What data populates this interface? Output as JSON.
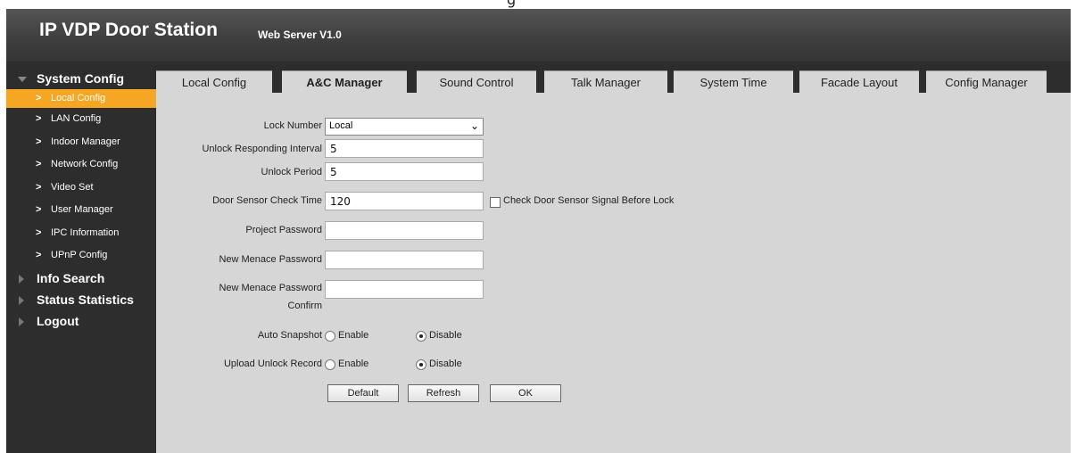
{
  "top_label": "g",
  "header": {
    "title": "IP VDP Door Station",
    "subtitle": "Web Server V1.0"
  },
  "sidebar": {
    "system_config": "System Config",
    "items": [
      "Local Config",
      "LAN Config",
      "Indoor Manager",
      "Network Config",
      "Video Set",
      "User Manager",
      "IPC Information",
      "UPnP Config"
    ],
    "info_search": "Info Search",
    "status_statistics": "Status Statistics",
    "logout": "Logout",
    "chevron": ">"
  },
  "tabs": [
    "Local Config",
    "A&C Manager",
    "Sound Control",
    "Talk Manager",
    "System Time",
    "Facade Layout",
    "Config Manager"
  ],
  "form": {
    "lock_number_label": "Lock Number",
    "lock_number_value": "Local",
    "unlock_interval_label": "Unlock Responding Interval",
    "unlock_interval_value": "5",
    "unlock_period_label": "Unlock Period",
    "unlock_period_value": "5",
    "door_sensor_label": "Door Sensor Check Time",
    "door_sensor_value": "120",
    "check_signal_label": "Check Door Sensor Signal Before Lock",
    "project_password_label": "Project Password",
    "menace_password_label": "New Menace Password",
    "menace_confirm_label_1": "New Menace Password",
    "menace_confirm_label_2": "Confirm",
    "auto_snapshot_label": "Auto Snapshot",
    "upload_unlock_label": "Upload Unlock Record",
    "enable": "Enable",
    "disable": "Disable",
    "caret": "⌄"
  },
  "buttons": {
    "default": "Default",
    "refresh": "Refresh",
    "ok": "OK"
  },
  "colors": {
    "header_bg": "#3f3f3f",
    "sidebar_bg": "#2d2d2d",
    "active_item": "#f5a623",
    "content_bg": "#d6d6d6"
  }
}
